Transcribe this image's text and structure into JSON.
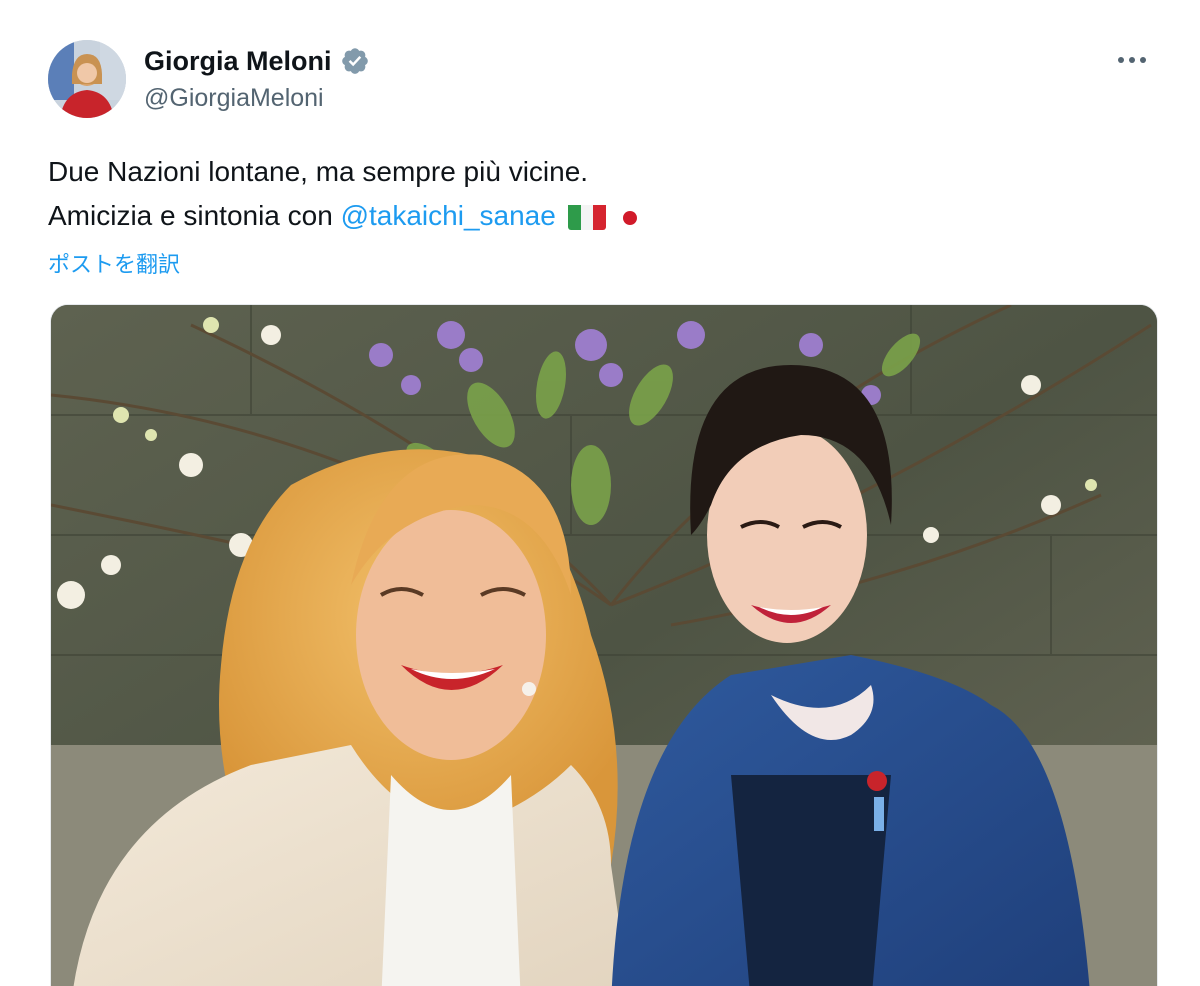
{
  "author": {
    "display_name": "Giorgia Meloni",
    "handle": "@GiorgiaMeloni",
    "verified_icon": "verified-badge-icon",
    "avatar_icon": "profile-avatar"
  },
  "menu": {
    "more_icon": "more-options-icon"
  },
  "tweet": {
    "line1": "Due Nazioni lontane, ma sempre più vicine.",
    "line2_prefix": "Amicizia e sintonia con ",
    "mention": "@takaichi_sanae",
    "emojis": [
      "italy-flag-icon",
      "japan-flag-icon"
    ]
  },
  "translate_label": "ポストを翻訳",
  "media": {
    "type": "photo",
    "subject": "selfie-photo"
  },
  "colors": {
    "text": "#0f1419",
    "secondary": "#536471",
    "link": "#1d9bf0",
    "verified": "#829aab"
  }
}
